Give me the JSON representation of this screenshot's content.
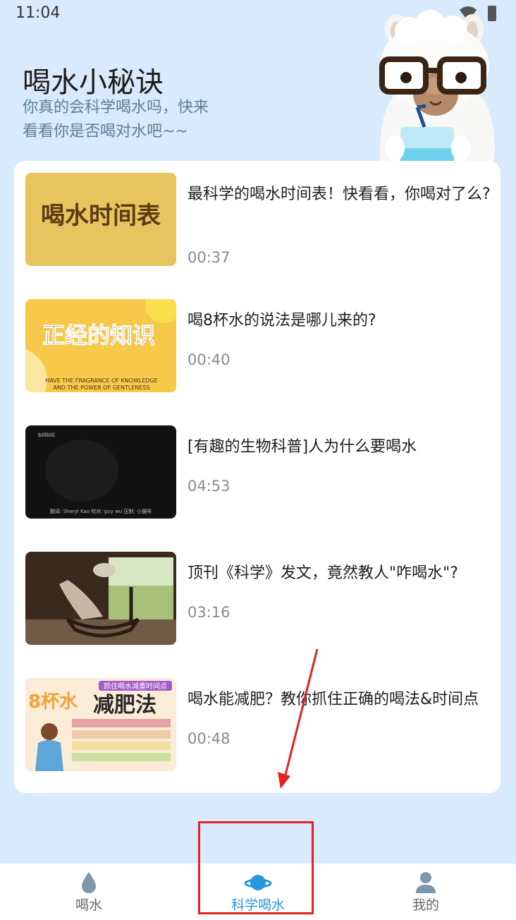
{
  "status_bar": {
    "time": "11:04"
  },
  "header": {
    "title": "喝水小秘诀",
    "subtitle_line1": "你真的会科学喝水吗，快来",
    "subtitle_line2": "看看你是否喝对水吧~~"
  },
  "videos": [
    {
      "title": "最科学的喝水时间表！快看看，你喝对了么?",
      "duration": "00:37",
      "thumb_text": "喝水时间表"
    },
    {
      "title": "喝8杯水的说法是哪儿来的?",
      "duration": "00:40",
      "thumb_text": "正经的知识",
      "thumb_sub1": "HAVE THE FRAGRANCE OF KNOWLEDGE",
      "thumb_sub2": "AND THE POWER OF GENTLENESS"
    },
    {
      "title": "[有趣的生物科普]人为什么要喝水",
      "duration": "04:53",
      "thumb_caption": "翻译: Sheryl Kao 校对: guy wu 压制: 小猫咪",
      "thumb_badge": "bilibili"
    },
    {
      "title": "顶刊《科学》发文，竟然教人\"咋喝水\"?",
      "duration": "03:16"
    },
    {
      "title": "喝水能减肥？教你抓住正确的喝法&时间点",
      "duration": "00:48",
      "thumb_tag": "抓住喝水减重时间点",
      "thumb_big1": "8杯水",
      "thumb_big2": "减肥法"
    }
  ],
  "bottom_nav": [
    {
      "label": "喝水",
      "icon": "water-drop-icon",
      "active": false
    },
    {
      "label": "科学喝水",
      "icon": "planet-icon",
      "active": true
    },
    {
      "label": "我的",
      "icon": "person-icon",
      "active": false
    }
  ],
  "colors": {
    "accent": "#2a95e0",
    "background": "#d8eafb",
    "annotation": "#e32222"
  }
}
